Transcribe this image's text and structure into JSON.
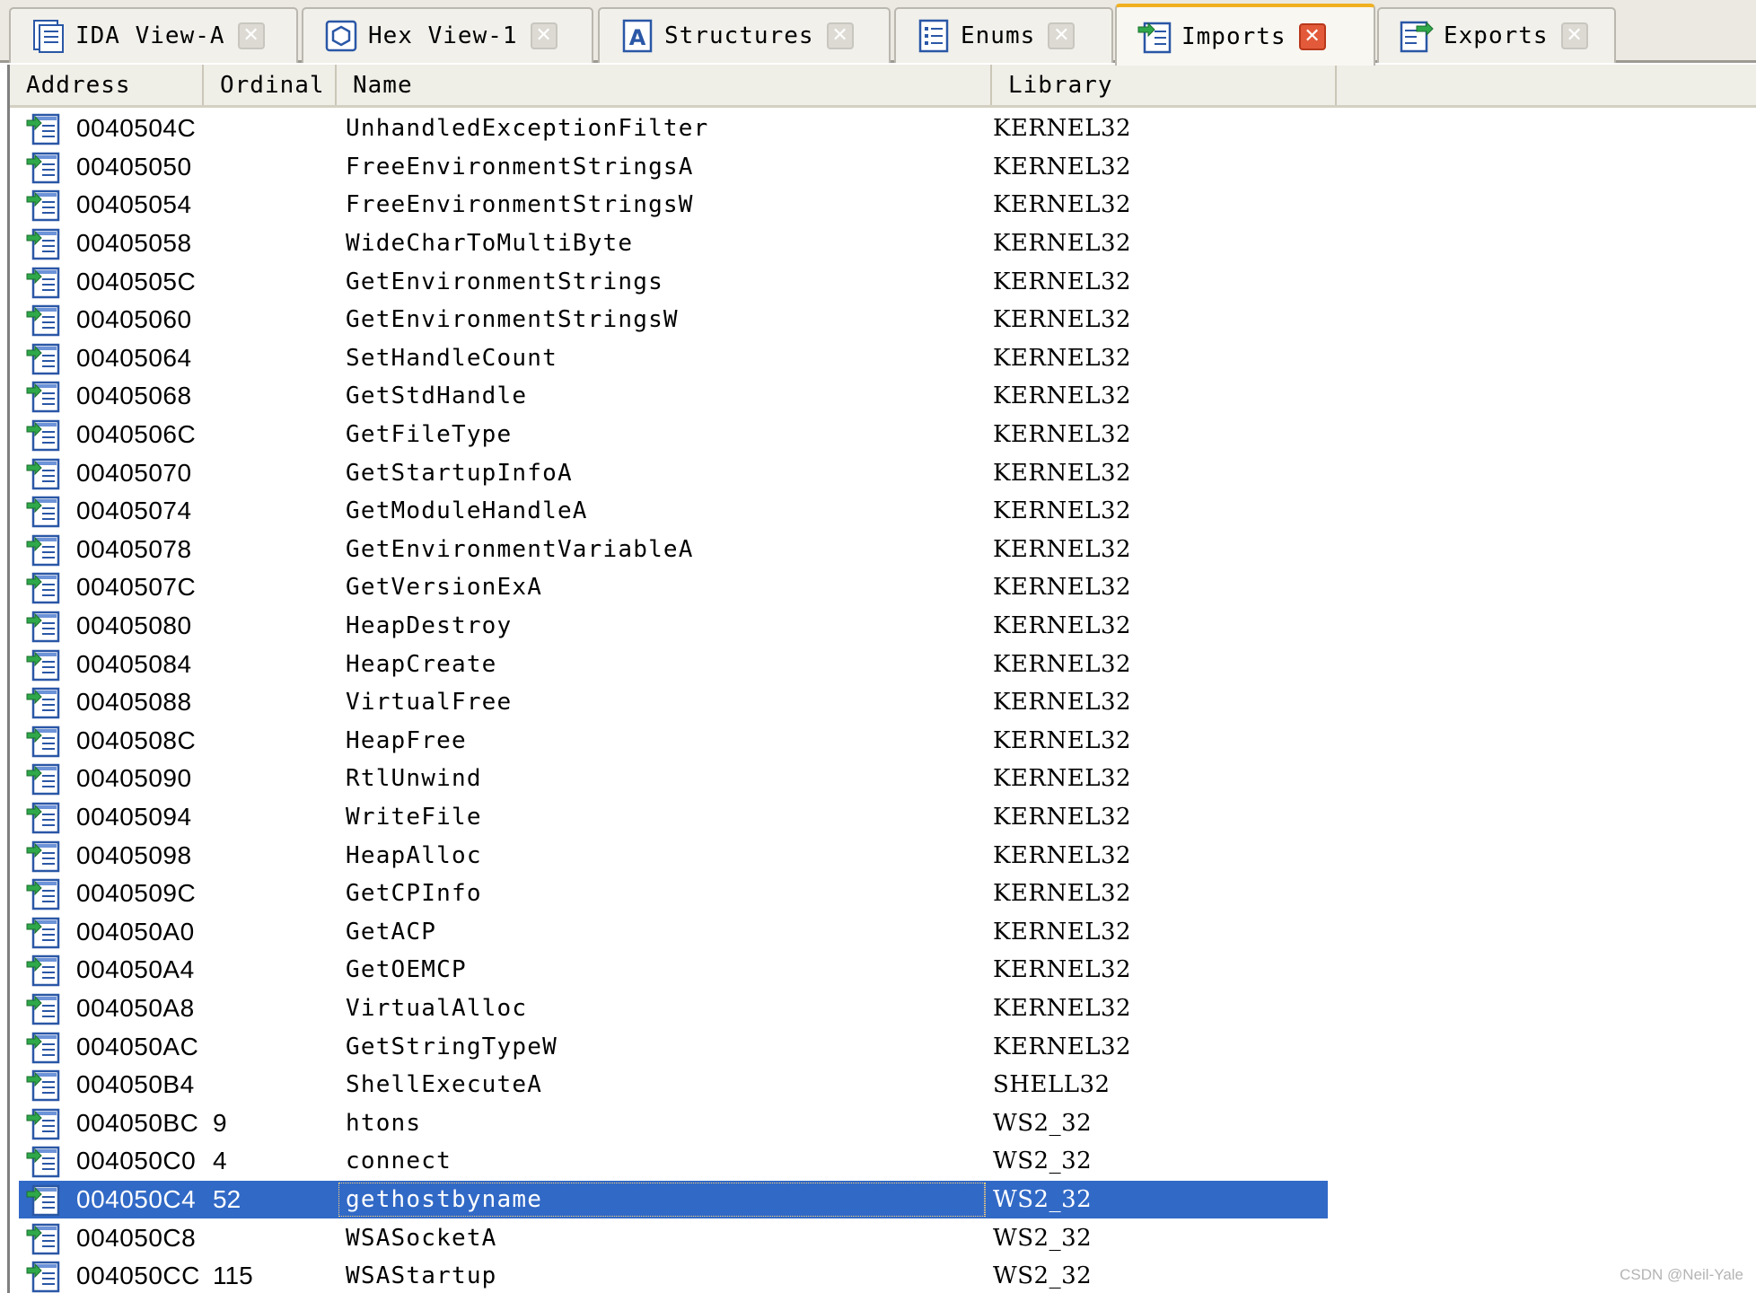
{
  "tabs": [
    {
      "label": "IDA View-A",
      "icon": "ida-view-icon",
      "active": false
    },
    {
      "label": "Hex View-1",
      "icon": "hex-view-icon",
      "active": false
    },
    {
      "label": "Structures",
      "icon": "structures-icon",
      "active": false
    },
    {
      "label": "Enums",
      "icon": "enums-icon",
      "active": false
    },
    {
      "label": "Imports",
      "icon": "imports-icon",
      "active": true
    },
    {
      "label": "Exports",
      "icon": "exports-icon",
      "active": false
    }
  ],
  "tab_close_glyph": "✕",
  "columns": {
    "address": "Address",
    "ordinal": "Ordinal",
    "name": "Name",
    "library": "Library"
  },
  "rows": [
    {
      "address": "0040504C",
      "ordinal": "",
      "name": "UnhandledExceptionFilter",
      "library": "KERNEL32"
    },
    {
      "address": "00405050",
      "ordinal": "",
      "name": "FreeEnvironmentStringsA",
      "library": "KERNEL32"
    },
    {
      "address": "00405054",
      "ordinal": "",
      "name": "FreeEnvironmentStringsW",
      "library": "KERNEL32"
    },
    {
      "address": "00405058",
      "ordinal": "",
      "name": "WideCharToMultiByte",
      "library": "KERNEL32"
    },
    {
      "address": "0040505C",
      "ordinal": "",
      "name": "GetEnvironmentStrings",
      "library": "KERNEL32"
    },
    {
      "address": "00405060",
      "ordinal": "",
      "name": "GetEnvironmentStringsW",
      "library": "KERNEL32"
    },
    {
      "address": "00405064",
      "ordinal": "",
      "name": "SetHandleCount",
      "library": "KERNEL32"
    },
    {
      "address": "00405068",
      "ordinal": "",
      "name": "GetStdHandle",
      "library": "KERNEL32"
    },
    {
      "address": "0040506C",
      "ordinal": "",
      "name": "GetFileType",
      "library": "KERNEL32"
    },
    {
      "address": "00405070",
      "ordinal": "",
      "name": "GetStartupInfoA",
      "library": "KERNEL32"
    },
    {
      "address": "00405074",
      "ordinal": "",
      "name": "GetModuleHandleA",
      "library": "KERNEL32"
    },
    {
      "address": "00405078",
      "ordinal": "",
      "name": "GetEnvironmentVariableA",
      "library": "KERNEL32"
    },
    {
      "address": "0040507C",
      "ordinal": "",
      "name": "GetVersionExA",
      "library": "KERNEL32"
    },
    {
      "address": "00405080",
      "ordinal": "",
      "name": "HeapDestroy",
      "library": "KERNEL32"
    },
    {
      "address": "00405084",
      "ordinal": "",
      "name": "HeapCreate",
      "library": "KERNEL32"
    },
    {
      "address": "00405088",
      "ordinal": "",
      "name": "VirtualFree",
      "library": "KERNEL32"
    },
    {
      "address": "0040508C",
      "ordinal": "",
      "name": "HeapFree",
      "library": "KERNEL32"
    },
    {
      "address": "00405090",
      "ordinal": "",
      "name": "RtlUnwind",
      "library": "KERNEL32"
    },
    {
      "address": "00405094",
      "ordinal": "",
      "name": "WriteFile",
      "library": "KERNEL32"
    },
    {
      "address": "00405098",
      "ordinal": "",
      "name": "HeapAlloc",
      "library": "KERNEL32"
    },
    {
      "address": "0040509C",
      "ordinal": "",
      "name": "GetCPInfo",
      "library": "KERNEL32"
    },
    {
      "address": "004050A0",
      "ordinal": "",
      "name": "GetACP",
      "library": "KERNEL32"
    },
    {
      "address": "004050A4",
      "ordinal": "",
      "name": "GetOEMCP",
      "library": "KERNEL32"
    },
    {
      "address": "004050A8",
      "ordinal": "",
      "name": "VirtualAlloc",
      "library": "KERNEL32"
    },
    {
      "address": "004050AC",
      "ordinal": "",
      "name": "GetStringTypeW",
      "library": "KERNEL32"
    },
    {
      "address": "004050B4",
      "ordinal": "",
      "name": "ShellExecuteA",
      "library": "SHELL32"
    },
    {
      "address": "004050BC",
      "ordinal": "9",
      "name": "htons",
      "library": "WS2_32"
    },
    {
      "address": "004050C0",
      "ordinal": "4",
      "name": "connect",
      "library": "WS2_32"
    },
    {
      "address": "004050C4",
      "ordinal": "52",
      "name": "gethostbyname",
      "library": "WS2_32",
      "selected": true
    },
    {
      "address": "004050C8",
      "ordinal": "",
      "name": "WSASocketA",
      "library": "WS2_32"
    },
    {
      "address": "004050CC",
      "ordinal": "115",
      "name": "WSAStartup",
      "library": "WS2_32"
    }
  ],
  "row_icon": "import-entry-icon",
  "watermark": "CSDN @Neil-Yale",
  "colors": {
    "selection": "#3169c6",
    "active_tab_accent": "#f0b020",
    "active_close": "#e25a3a"
  }
}
